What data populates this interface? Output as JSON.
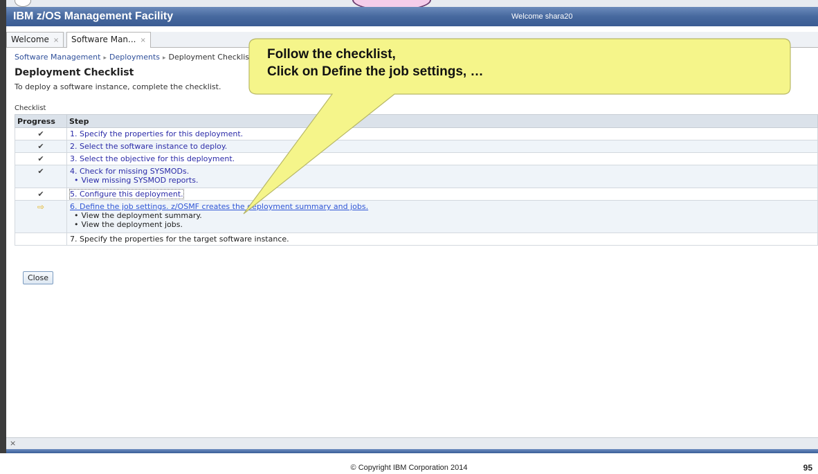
{
  "app": {
    "title": "IBM z/OS Management Facility",
    "welcome": "Welcome shara20"
  },
  "tabs": [
    {
      "label": "Welcome",
      "close": "×"
    },
    {
      "label": "Software Man...",
      "close": "×"
    }
  ],
  "breadcrumb": {
    "items": [
      "Software Management",
      "Deployments",
      "Deployment Checklist"
    ],
    "separator": "▸"
  },
  "page": {
    "title": "Deployment Checklist",
    "description": "To deploy a software instance, complete the checklist."
  },
  "checklist": {
    "label": "Checklist",
    "headers": [
      "Progress",
      "Step"
    ],
    "rows": [
      {
        "progress": "check-icon",
        "step": "1. Specify the properties for this deployment.",
        "subs": []
      },
      {
        "progress": "check-icon",
        "step": "2. Select the software instance to deploy.",
        "subs": []
      },
      {
        "progress": "check-icon",
        "step": "3. Select the objective for this deployment.",
        "subs": []
      },
      {
        "progress": "check-icon",
        "step": "4. Check for missing SYSMODs.",
        "subs": [
          "View missing SYSMOD reports."
        ]
      },
      {
        "progress": "check-icon",
        "step": "5. Configure this deployment.",
        "subs": []
      },
      {
        "progress": "arrow-icon",
        "step": "6. Define the job settings. z/OSMF creates the deployment summary and jobs.",
        "subs": [
          "View the deployment summary.",
          "View the deployment jobs."
        ]
      },
      {
        "progress": "",
        "step": "7. Specify the properties for the target software instance.",
        "subs": []
      }
    ]
  },
  "buttons": {
    "close": "Close"
  },
  "callout": {
    "line1": "Follow the checklist,",
    "line2": "Click on Define the job settings, …",
    "color": "#f5f58a"
  },
  "bottom_bar": {
    "close": "×"
  },
  "footer": {
    "copyright": "© Copyright IBM Corporation 2014",
    "page_number": "95"
  }
}
